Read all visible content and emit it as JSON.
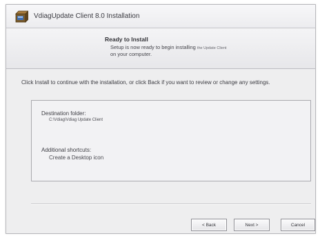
{
  "window": {
    "title": "VdiagUpdate Client 8.0 Installation"
  },
  "header": {
    "title": "Ready to Install",
    "line1_prefix": "Setup is now ready to begin installing",
    "line1_app": "the Update Client",
    "line2": "on your computer."
  },
  "main": {
    "instructions": "Click Install to continue with the installation, or click Back if you want to review or change any settings.",
    "destination_label": "Destination folder:",
    "destination_value": "C:\\Vdiag\\Vdiag Update Client",
    "shortcuts_label": "Additional shortcuts:",
    "shortcuts_value": "Create a Desktop icon"
  },
  "buttons": {
    "back": "< Back",
    "next": "Next >",
    "cancel": "Cancel"
  },
  "icons": {
    "app": "installer-box-icon"
  }
}
